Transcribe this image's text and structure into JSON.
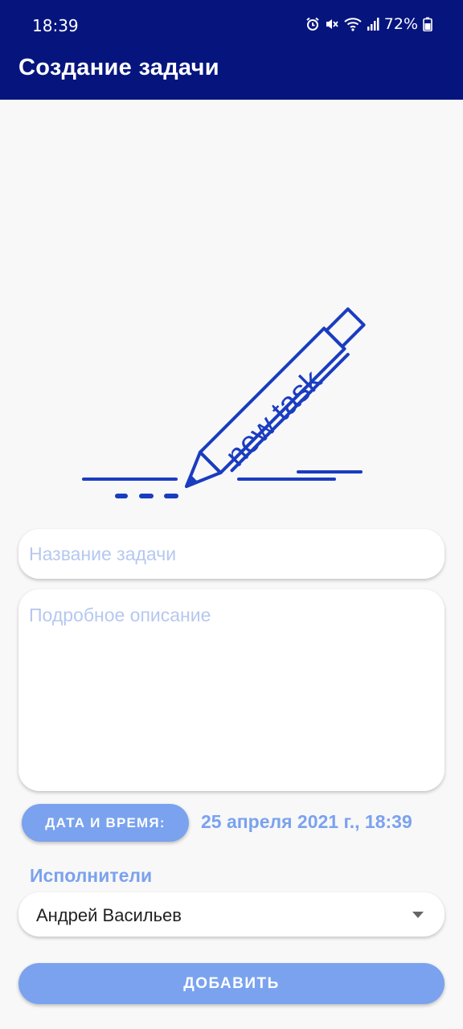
{
  "status_bar": {
    "time": "18:39",
    "battery": "72%",
    "icons": [
      "alarm-icon",
      "mute-icon",
      "wifi-icon",
      "signal-icon",
      "battery-icon"
    ]
  },
  "header": {
    "title": "Создание задачи"
  },
  "illustration": {
    "text": "new task",
    "color": "#1a3cc0"
  },
  "form": {
    "title_placeholder": "Название задачи",
    "description_placeholder": "Подробное описание",
    "date_button_label": "ДАТА И ВРЕМЯ:",
    "date_value": "25 апреля 2021 г., 18:39",
    "assignees_label": "Исполнители",
    "assignee_selected": "Андрей Васильев",
    "submit_label": "ДОБАВИТЬ"
  },
  "colors": {
    "appbar": "#06157e",
    "accent": "#7aa2ee",
    "placeholder": "#b6c8f0"
  }
}
